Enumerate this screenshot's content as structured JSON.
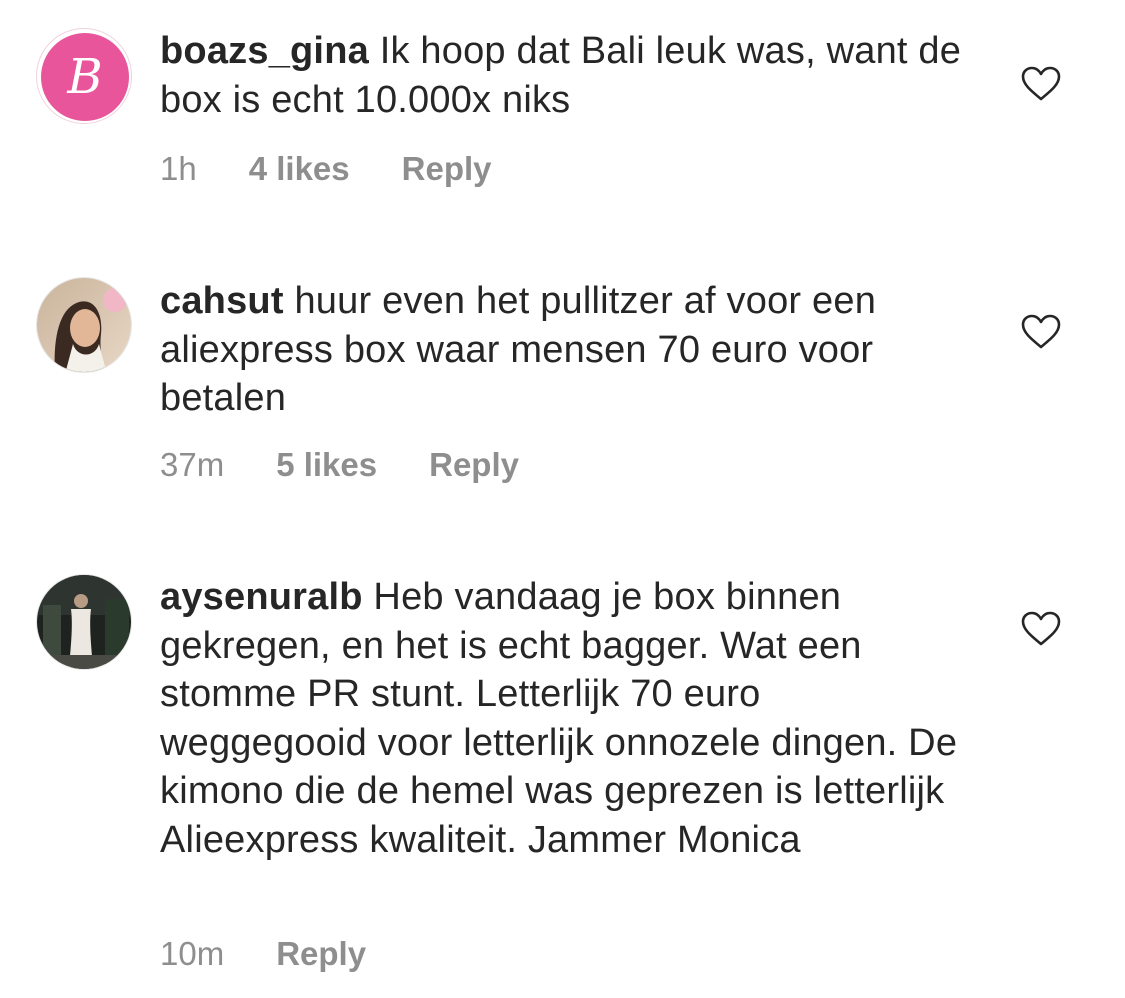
{
  "comments": [
    {
      "username": "boazs_gina",
      "text": "Ik hoop dat Bali leuk was, want de box is echt 10.000x niks",
      "time": "1h",
      "likes": "4 likes",
      "reply": "Reply",
      "avatar_icon": "pink-b-logo-avatar",
      "avatar_letter": "B"
    },
    {
      "username": "cahsut",
      "text": "huur even het pullitzer af voor een aliexpress box waar mensen 70 euro voor betalen",
      "time": "37m",
      "likes": "5 likes",
      "reply": "Reply",
      "avatar_icon": "profile-photo-avatar"
    },
    {
      "username": "aysenuralb",
      "text": "Heb vandaag je box binnen gekregen, en het is echt bagger. Wat een stomme PR stunt. Letterlijk 70 euro weggegooid voor letterlijk onnozele dingen. De kimono die de hemel was geprezen is letterlijk Alieexpress kwaliteit. Jammer Monica",
      "time": "10m",
      "reply": "Reply",
      "avatar_icon": "profile-photo-avatar"
    }
  ],
  "colors": {
    "text": "#262626",
    "meta": "#8e8e8e",
    "brand_pink": "#e8559a"
  },
  "icons": {
    "like": "heart-outline-icon"
  }
}
